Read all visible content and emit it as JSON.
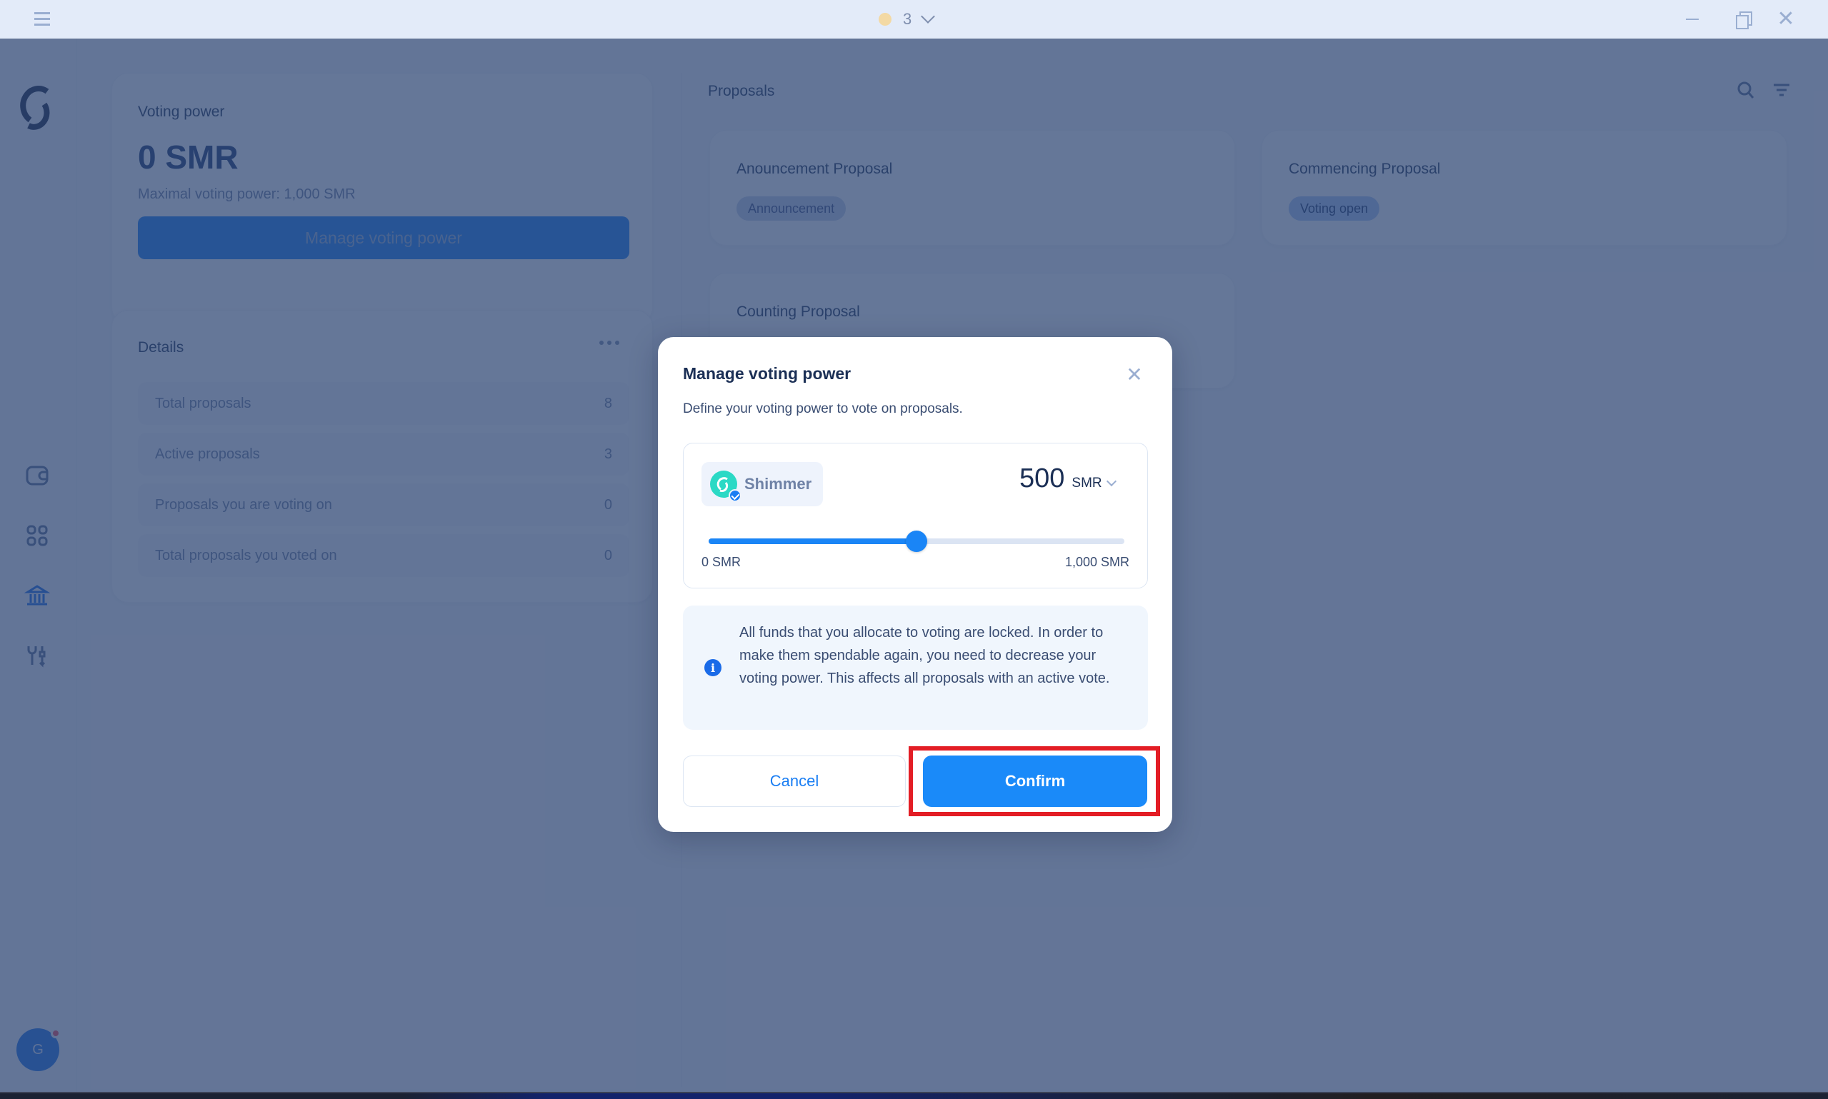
{
  "titlebar": {
    "menu_icon": "hamburger-menu-icon",
    "activity_count": "3",
    "status_dot_color": "#f3d9a4",
    "window_controls": [
      "minimize",
      "restore",
      "close"
    ]
  },
  "sidebar": {
    "logo": "shimmer-logo",
    "items": [
      {
        "id": "wallet",
        "icon": "wallet-icon",
        "active": false
      },
      {
        "id": "collectibles",
        "icon": "grid-icon",
        "active": false
      },
      {
        "id": "governance",
        "icon": "bank-icon",
        "active": true
      },
      {
        "id": "developer",
        "icon": "tools-icon",
        "active": false
      }
    ],
    "avatar_initial": "G",
    "has_notification": true
  },
  "voting_power": {
    "label": "Voting power",
    "amount": "0 SMR",
    "max_text": "Maximal voting power: 1,000 SMR",
    "button_label": "Manage voting power"
  },
  "details": {
    "title": "Details",
    "rows": [
      {
        "label": "Total proposals",
        "value": "8"
      },
      {
        "label": "Active proposals",
        "value": "3"
      },
      {
        "label": "Proposals you are voting on",
        "value": "0"
      },
      {
        "label": "Total proposals you voted on",
        "value": "0"
      }
    ]
  },
  "proposals": {
    "title": "Proposals",
    "items": [
      {
        "name": "Anouncement Proposal",
        "status": "Announcement"
      },
      {
        "name": "Commencing Proposal",
        "status": "Voting open"
      },
      {
        "name": "Counting Proposal",
        "status": ""
      }
    ]
  },
  "modal": {
    "title": "Manage voting power",
    "subtitle": "Define your voting power to vote on proposals.",
    "token_name": "Shimmer",
    "amount": "500",
    "unit": "SMR",
    "slider": {
      "min": 0,
      "max": 1000,
      "value": 500,
      "min_label": "0 SMR",
      "max_label": "1,000 SMR"
    },
    "info_text": "All funds that you allocate to voting are locked. In order to make them spendable again, you need to decrease your voting power. This affects all proposals with an active vote.",
    "cancel_label": "Cancel",
    "confirm_label": "Confirm"
  },
  "colors": {
    "accent": "#1a8af9",
    "highlight": "#e31d25",
    "token": "#2bd9c5"
  }
}
